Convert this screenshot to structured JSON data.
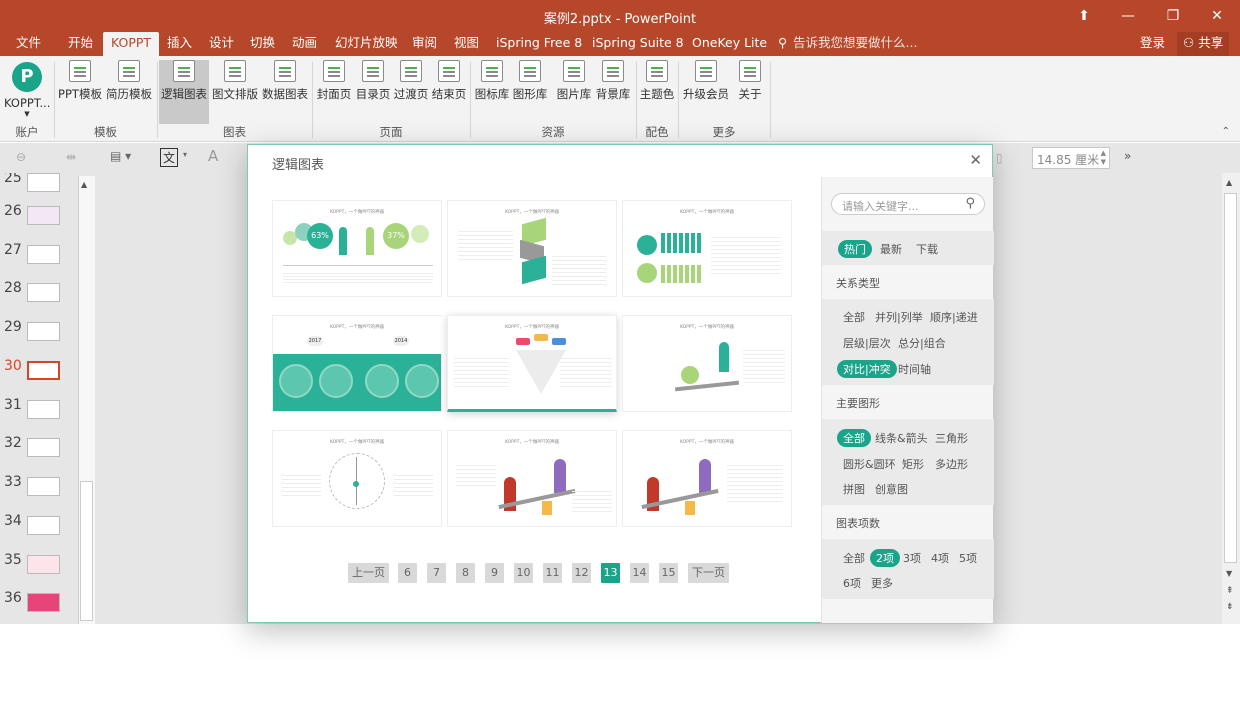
{
  "window": {
    "title": "案例2.pptx - PowerPoint",
    "sign_in": "登录",
    "share": "共享"
  },
  "menu": [
    {
      "label": "文件"
    },
    {
      "label": "开始"
    },
    {
      "label": "KOPPT"
    },
    {
      "label": "插入"
    },
    {
      "label": "设计"
    },
    {
      "label": "切换"
    },
    {
      "label": "动画"
    },
    {
      "label": "幻灯片放映"
    },
    {
      "label": "审阅"
    },
    {
      "label": "视图"
    },
    {
      "label": "iSpring Free 8"
    },
    {
      "label": "iSpring Suite 8"
    },
    {
      "label": "OneKey Lite"
    },
    {
      "label": "告诉我您想要做什么..."
    }
  ],
  "ribbon": {
    "buttons": [
      {
        "label": "KOPPT..."
      },
      {
        "label": "PPT模板"
      },
      {
        "label": "简历模板"
      },
      {
        "label": "逻辑图表"
      },
      {
        "label": "图文排版"
      },
      {
        "label": "数据图表"
      },
      {
        "label": "封面页"
      },
      {
        "label": "目录页"
      },
      {
        "label": "过渡页"
      },
      {
        "label": "结束页"
      },
      {
        "label": "图标库"
      },
      {
        "label": "图形库"
      },
      {
        "label": "图片库"
      },
      {
        "label": "背景库"
      },
      {
        "label": "主题色"
      },
      {
        "label": "升级会员"
      },
      {
        "label": "关于"
      }
    ],
    "groups": [
      {
        "label": "账户"
      },
      {
        "label": "模板"
      },
      {
        "label": "图表"
      },
      {
        "label": "页面"
      },
      {
        "label": "资源"
      },
      {
        "label": "配色"
      },
      {
        "label": "更多"
      }
    ]
  },
  "toolbar": {
    "size_value": "14.85 厘米",
    "text_icon": "文",
    "font_icon": "A"
  },
  "thumbnails": {
    "numbers": [
      "25",
      "26",
      "27",
      "28",
      "29",
      "30",
      "31",
      "32",
      "33",
      "34",
      "35",
      "36"
    ],
    "current": "30"
  },
  "dialog": {
    "title": "逻辑图表",
    "card_caption": "KOPPT，一个做PPT的神器",
    "card1_pct_a": "63%",
    "card1_pct_b": "37%",
    "card4_year_a": "2017",
    "card4_year_b": "2014",
    "pager": {
      "prev": "上一页",
      "pages": [
        "6",
        "7",
        "8",
        "9",
        "10",
        "11",
        "12",
        "13",
        "14",
        "15"
      ],
      "current": "13",
      "next": "下一页"
    },
    "sidebar": {
      "search_placeholder": "请输入关键字...",
      "sort": [
        "热门",
        "最新",
        "下载"
      ],
      "relation_title": "关系类型",
      "relation": [
        "全部",
        "并列|列举",
        "顺序|递进",
        "层级|层次",
        "总分|组合",
        "对比|冲突",
        "时间轴"
      ],
      "shape_title": "主要图形",
      "shapes": [
        "全部",
        "线条&箭头",
        "三角形",
        "圆形&圆环",
        "矩形",
        "多边形",
        "拼图",
        "创意图"
      ],
      "count_title": "图表项数",
      "counts": [
        "全部",
        "2项",
        "3项",
        "4项",
        "5项",
        "6项",
        "更多"
      ]
    }
  },
  "colors": {
    "accent": "#b7472a",
    "teal": "#1aa58a"
  }
}
